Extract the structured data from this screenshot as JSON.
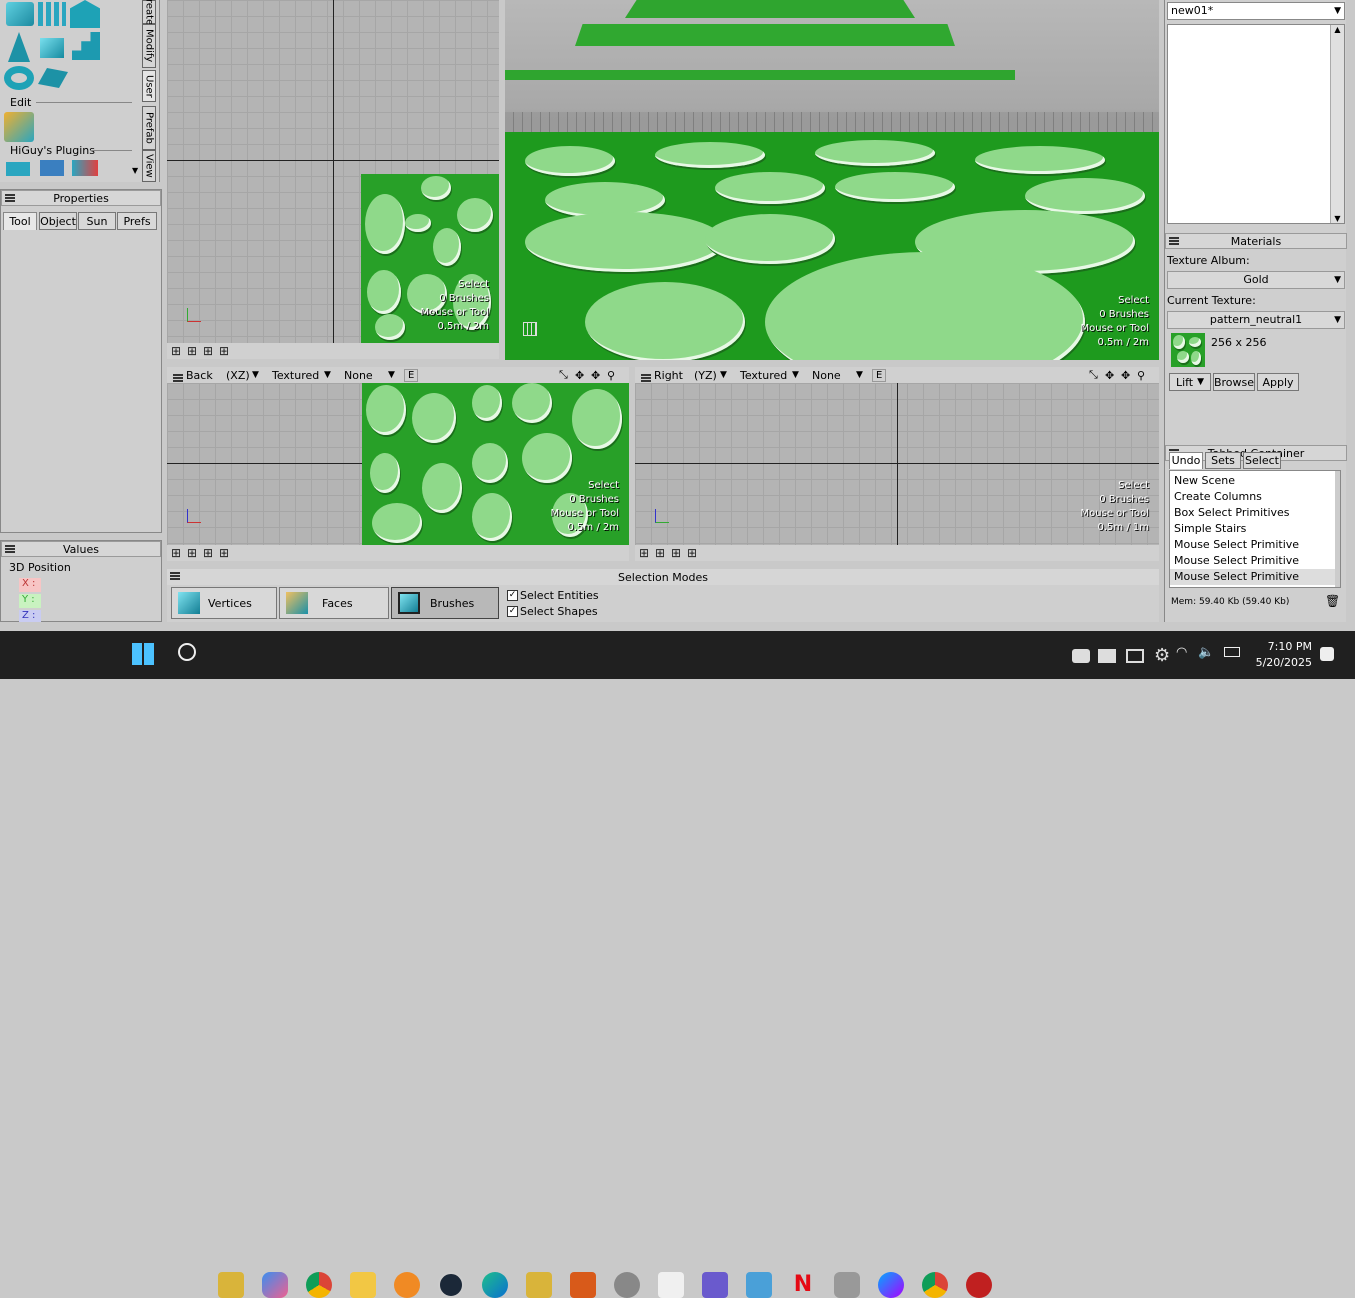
{
  "left_panel": {
    "section_edit": "Edit",
    "section_plugins": "HiGuy's Plugins",
    "vertical_tabs": [
      "reate",
      "Modify",
      "User",
      "Prefab",
      "View"
    ]
  },
  "properties": {
    "title": "Properties",
    "tabs": [
      "Tool",
      "Object",
      "Sun",
      "Prefs"
    ]
  },
  "values": {
    "title": "Values",
    "label": "3D Position",
    "axes": [
      "X :",
      "Y :",
      "Z :"
    ]
  },
  "viewports": {
    "overlay_lines": [
      "Select",
      "0 Brushes",
      "Mouse or Tool"
    ],
    "top_scale": "0.5m / 2m",
    "persp_scale": "0.5m / 2m",
    "back_scale": "0.5m / 2m",
    "right_scale": "0.5m / 1m",
    "back": {
      "view": "Back",
      "axis": "(XZ)",
      "mode": "Textured",
      "filter": "None",
      "e": "E"
    },
    "right": {
      "view": "Right",
      "axis": "(YZ)",
      "mode": "Textured",
      "filter": "None",
      "e": "E"
    }
  },
  "selection": {
    "title": "Selection Modes",
    "modes": [
      "Vertices",
      "Faces",
      "Brushes"
    ],
    "checks": [
      "Select Entities",
      "Select Shapes"
    ]
  },
  "right_panel": {
    "scene_name": "new01*",
    "materials_title": "Materials",
    "texture_album_label": "Texture Album:",
    "texture_album_value": "Gold",
    "current_texture_label": "Current Texture:",
    "current_texture_value": "pattern_neutral1",
    "texture_size": "256 x 256",
    "buttons": {
      "lift": "Lift",
      "browse": "Browse",
      "apply": "Apply"
    },
    "tabbed_title": "Tabbed Container",
    "tabs": [
      "Undo",
      "Sets",
      "Select"
    ],
    "undo_list": [
      "New Scene",
      "Create Columns",
      "Box Select Primitives",
      "Simple Stairs",
      "Mouse Select Primitive",
      "Mouse Select Primitive",
      "Mouse Select Primitive"
    ],
    "mem": "Mem: 59.40 Kb (59.40 Kb)"
  },
  "taskbar": {
    "time": "7:10 PM",
    "date": "5/20/2025"
  },
  "colors": {
    "accent_green": "#28a028",
    "light_green": "#8fd98a",
    "taskbar": "#202020"
  }
}
